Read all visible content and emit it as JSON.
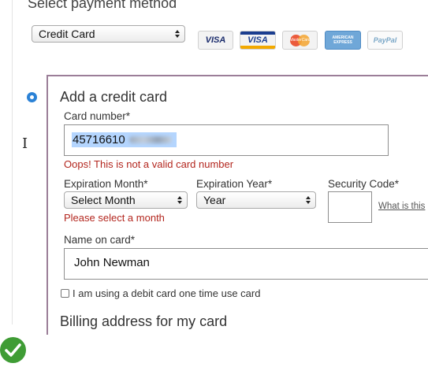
{
  "page": {
    "title": "Select payment method"
  },
  "payment_type": {
    "selected": "Credit Card"
  },
  "card_logos": [
    {
      "icon": "visa-icon",
      "text": "VISA"
    },
    {
      "icon": "visa-gold-icon",
      "text": "VISA"
    },
    {
      "icon": "mastercard-icon",
      "text": "MasterCard"
    },
    {
      "icon": "amex-icon",
      "text": "AMERICAN EXPRESS"
    },
    {
      "icon": "paypal-icon",
      "text": "PayPal"
    }
  ],
  "credit_card_form": {
    "heading": "Add a credit card",
    "card_number": {
      "label": "Card number*",
      "value_visible": "45716610",
      "error": "Oops! This is not a valid card number"
    },
    "expiration_month": {
      "label": "Expiration Month*",
      "selected": "Select Month",
      "error": "Please select a month"
    },
    "expiration_year": {
      "label": "Expiration Year*",
      "selected": "Year"
    },
    "security_code": {
      "label": "Security Code*",
      "value": "",
      "help_link": "What is this"
    },
    "name_on_card": {
      "label": "Name on card*",
      "value": "John Newman"
    },
    "debit_checkbox": {
      "label": "I am using a debit card one time use card",
      "checked": false
    }
  },
  "billing": {
    "heading": "Billing address for my card"
  },
  "colors": {
    "accent": "#2b82d6",
    "error": "#b3261e",
    "panel_border": "#9b7e98",
    "success": "#3f9c35"
  }
}
